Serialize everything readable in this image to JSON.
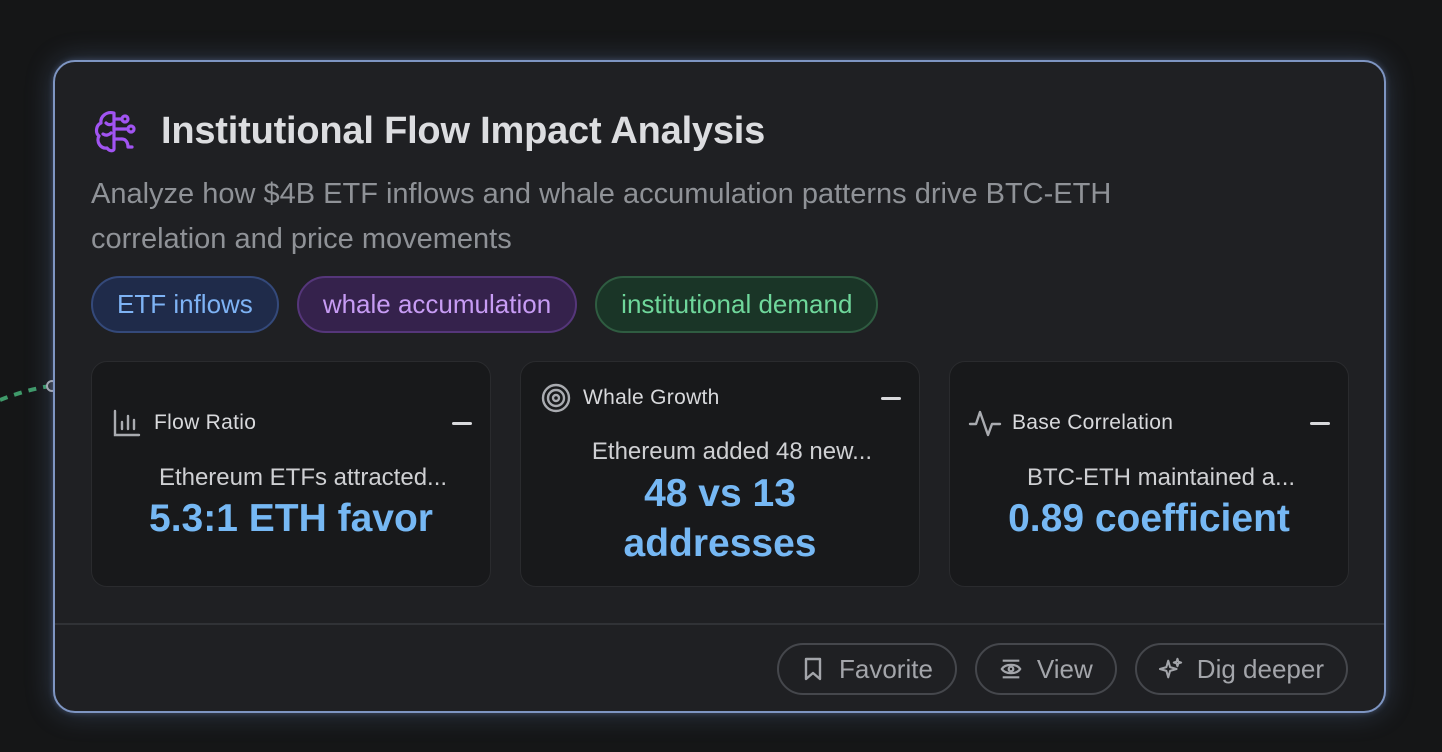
{
  "card": {
    "title": "Institutional Flow Impact Analysis",
    "subtitle": "Analyze how $4B ETF inflows and whale accumulation patterns drive BTC-ETH correlation and price movements",
    "icon": "brain-icon",
    "accent_color": "#a154f2"
  },
  "tags": [
    {
      "label": "ETF inflows",
      "color": "#7eb3f5"
    },
    {
      "label": "whale accumulation",
      "color": "#c79cf4"
    },
    {
      "label": "institutional demand",
      "color": "#6fd79b"
    }
  ],
  "metrics": [
    {
      "label": "Flow Ratio",
      "icon": "bar-chart-icon",
      "description": "Ethereum ETFs attracted...",
      "value": "5.3:1 ETH favor"
    },
    {
      "label": "Whale Growth",
      "icon": "target-icon",
      "description": "Ethereum added 48 new...",
      "value": "48 vs 13 addresses"
    },
    {
      "label": "Base Correlation",
      "icon": "activity-icon",
      "description": "BTC-ETH maintained a...",
      "value": "0.89 coefficient"
    }
  ],
  "actions": {
    "favorite": "Favorite",
    "view": "View",
    "dig_deeper": "Dig deeper"
  }
}
